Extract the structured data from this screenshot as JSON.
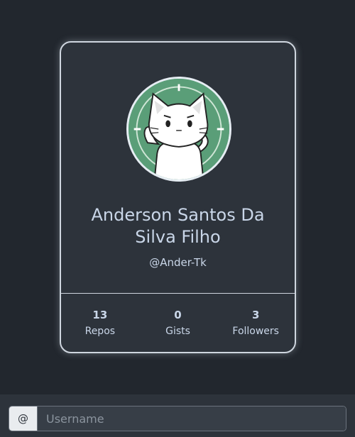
{
  "profile": {
    "name": "Anderson Santos Da Silva Filho",
    "login": "@Ander-Tk",
    "avatar_icon": "cat-avatar-icon"
  },
  "stats": [
    {
      "count": "13",
      "label": "Repos"
    },
    {
      "count": "0",
      "label": "Gists"
    },
    {
      "count": "3",
      "label": "Followers"
    }
  ],
  "search": {
    "prefix": "@",
    "value": "",
    "placeholder": "Username"
  },
  "colors": {
    "background": "#22272e",
    "card": "#2d333b",
    "avatar_bg": "#5a9e78",
    "text": "#c9d6e8"
  }
}
